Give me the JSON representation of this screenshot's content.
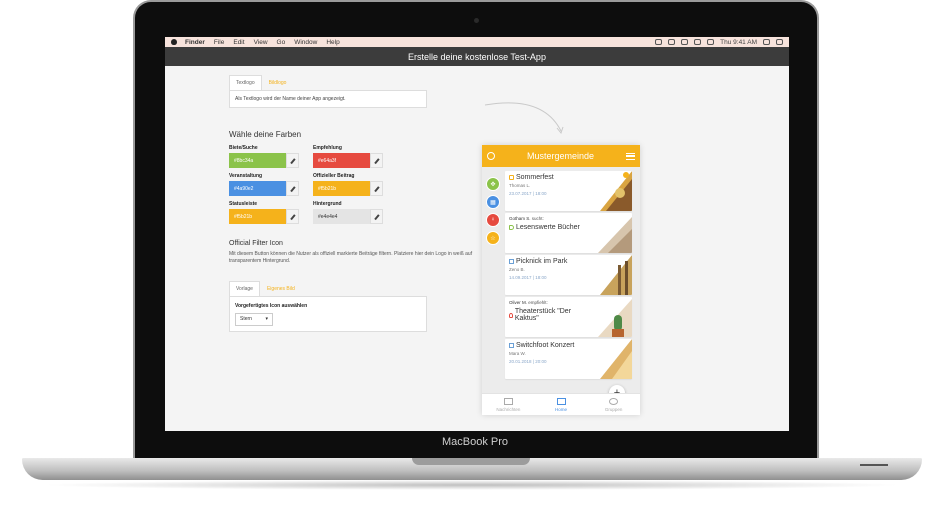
{
  "device": {
    "label": "MacBook Pro"
  },
  "menubar": {
    "app": "Finder",
    "items": [
      "File",
      "Edit",
      "View",
      "Go",
      "Window",
      "Help"
    ],
    "clock": "Thu 9:41 AM"
  },
  "window": {
    "title": "Erstelle deine kostenlose Test-App"
  },
  "logo_tabs": {
    "tabs": [
      "Textlogo",
      "Bildlogo"
    ],
    "description": "Als Textlogo wird der Name deiner App angezeigt."
  },
  "colors": {
    "heading": "Wähle deine Farben",
    "items": [
      {
        "label": "Biete/Suche",
        "value": "#8bc34a",
        "color": "#8bc34a"
      },
      {
        "label": "Empfehlung",
        "value": "#e64a3f",
        "color": "#e64a3f"
      },
      {
        "label": "Veranstaltung",
        "value": "#4a90e2",
        "color": "#4a90e2"
      },
      {
        "label": "Offizieller Beitrag",
        "value": "#f5b21b",
        "color": "#f5b21b"
      },
      {
        "label": "Statusleiste",
        "value": "#f5b21b",
        "color": "#f5b21b"
      },
      {
        "label": "Hintergrund",
        "value": "#e4e4e4",
        "color": "#e4e4e4"
      }
    ]
  },
  "filter_icon": {
    "heading": "Official Filter Icon",
    "description": "Mit diesem Button können die Nutzer als offiziell markierte Beiträge filtern. Platziere hier dein Logo in weiß auf transparentem Hintergrund.",
    "tabs": [
      "Vorlage",
      "Eigenes Bild"
    ],
    "select_label": "Vorgefertigtes Icon auswählen",
    "select_value": "Stern"
  },
  "app": {
    "title": "Mustergemeinde",
    "cards": [
      {
        "title": "Sommerfest",
        "sub": "Thomas L.",
        "date": "23.07.2017 | 18:00"
      },
      {
        "pre_name": "Gotham S.",
        "pre_verb": "sucht:",
        "title": "Lesenswerte Bücher"
      },
      {
        "title": "Picknick im Park",
        "sub": "Zeno B.",
        "date": "14.09.2017 | 18:00"
      },
      {
        "pre_name": "Oliver M.",
        "pre_verb": "empfiehlt:",
        "title": "Theaterstück \"Der Kaktus\""
      },
      {
        "title": "Switchfoot Konzert",
        "sub": "Mara W.",
        "date": "20.01.2018 | 20:00"
      }
    ],
    "fab": "+",
    "nav": [
      "Nachrichten",
      "Home",
      "Gruppen"
    ]
  }
}
